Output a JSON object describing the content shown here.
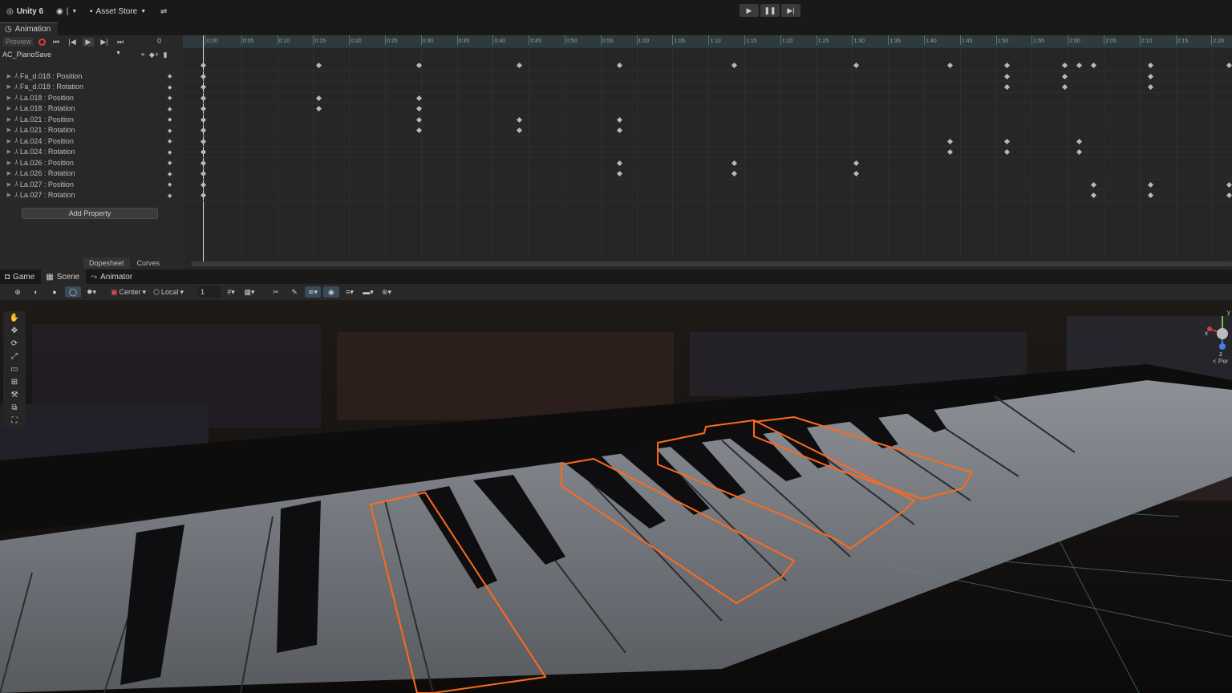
{
  "topbar": {
    "app": "Unity 6",
    "account": "|",
    "asset_store": "Asset Store"
  },
  "play": {
    "play": "▶",
    "pause": "❚❚",
    "step": "▶|"
  },
  "animation": {
    "tab": "Animation",
    "preview": "Preview",
    "frame": "0",
    "clip": "AC_PianoSave",
    "add_property": "Add Property",
    "bottom_tabs": [
      "Dopesheet",
      "Curves"
    ],
    "properties": [
      "Fa_d.018 : Position",
      "Fa_d.018 : Rotation",
      "La.018 : Position",
      "La.018 : Rotation",
      "La.021 : Position",
      "La.021 : Rotation",
      "La.024 : Position",
      "La.024 : Rotation",
      "La.026 : Position",
      "La.026 : Rotation",
      "La.027 : Position",
      "La.027 : Rotation"
    ],
    "ruler": [
      "0:00",
      "0:05",
      "0:10",
      "0:15",
      "0:20",
      "0:25",
      "0:30",
      "0:35",
      "0:40",
      "0:45",
      "0:50",
      "0:55",
      "1:00",
      "1:05",
      "1:10",
      "1:15",
      "1:20",
      "1:25",
      "1:30",
      "1:35",
      "1:40",
      "1:45",
      "1:50",
      "1:55",
      "2:00",
      "2:05",
      "2:10",
      "2:15",
      "2:20"
    ]
  },
  "scene_tabs": [
    "Game",
    "Scene",
    "Animator"
  ],
  "scene_toolbar": {
    "pivot": "Center",
    "space": "Local",
    "grid_value": "1"
  },
  "gizmo": {
    "y": "y",
    "x": "x",
    "z": "z",
    "persp": "< Per"
  },
  "colors": {
    "outline": "#ff6a1a",
    "record": "#d04040",
    "ruler_bg": "#2f3a3c"
  }
}
